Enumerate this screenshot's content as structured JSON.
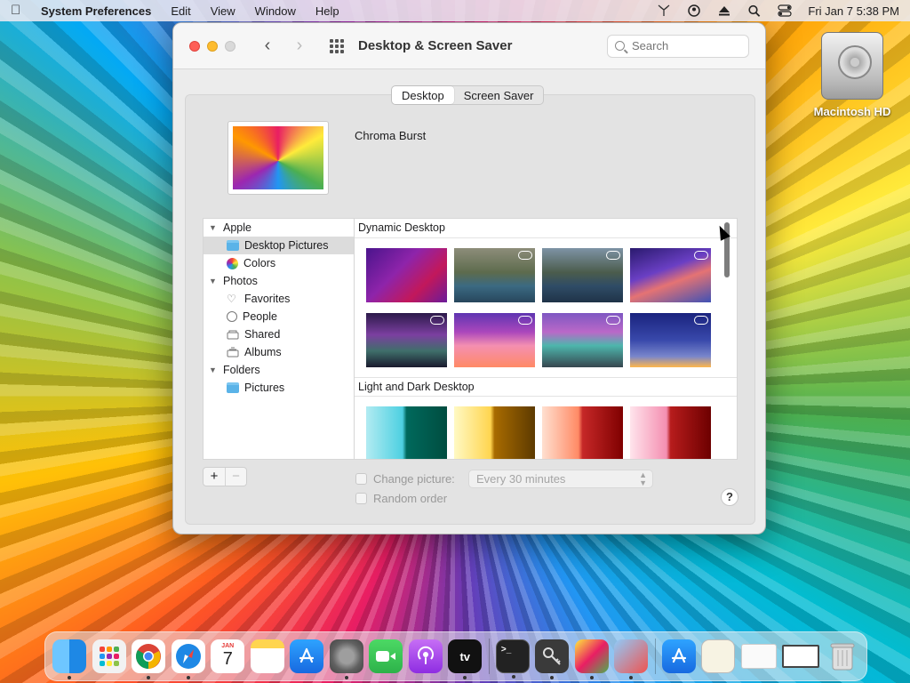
{
  "menubar": {
    "app_name": "System Preferences",
    "items": [
      "Edit",
      "View",
      "Window",
      "Help"
    ],
    "clock": "Fri Jan 7  5:38 PM",
    "status_icons": [
      "antenna-icon",
      "user-icon",
      "eject-icon",
      "search-icon",
      "control-center-icon"
    ]
  },
  "desktop": {
    "drive_label": "Macintosh HD"
  },
  "window": {
    "title": "Desktop & Screen Saver",
    "search_placeholder": "Search",
    "tabs": [
      {
        "label": "Desktop",
        "active": true
      },
      {
        "label": "Screen Saver",
        "active": false
      }
    ],
    "current_wallpaper": "Chroma Burst",
    "sidebar": {
      "groups": [
        {
          "label": "Apple",
          "items": [
            {
              "label": "Desktop Pictures",
              "icon": "folder-icon",
              "selected": true
            },
            {
              "label": "Colors",
              "icon": "color-wheel-icon"
            }
          ]
        },
        {
          "label": "Photos",
          "items": [
            {
              "label": "Favorites",
              "icon": "heart-icon"
            },
            {
              "label": "People",
              "icon": "person-circle-icon"
            },
            {
              "label": "Shared",
              "icon": "shared-album-icon"
            },
            {
              "label": "Albums",
              "icon": "album-stack-icon"
            }
          ]
        },
        {
          "label": "Folders",
          "items": [
            {
              "label": "Pictures",
              "icon": "folder-icon"
            }
          ]
        }
      ]
    },
    "sections": [
      {
        "title": "Dynamic Desktop"
      },
      {
        "title": "Light and Dark Desktop"
      }
    ],
    "add_button": "+",
    "remove_button": "−",
    "change_picture_label": "Change picture:",
    "interval_value": "Every 30 minutes",
    "random_order_label": "Random order",
    "help_label": "?"
  },
  "dock": {
    "apps": [
      "Finder",
      "Launchpad",
      "Chrome",
      "Safari",
      "Calendar",
      "Notes",
      "App Store",
      "System Preferences",
      "FaceTime",
      "Podcasts",
      "TV",
      "Terminal",
      "Keychain Access",
      "Preview",
      "Utility",
      "App Store",
      "Preview document",
      "Window",
      "Window",
      "Trash"
    ],
    "calendar_month": "JAN",
    "calendar_day": "7",
    "tv_label": "tv"
  },
  "colors": {
    "menubar_bg": "#ebe8f0",
    "accent": "#2e7bf6"
  }
}
